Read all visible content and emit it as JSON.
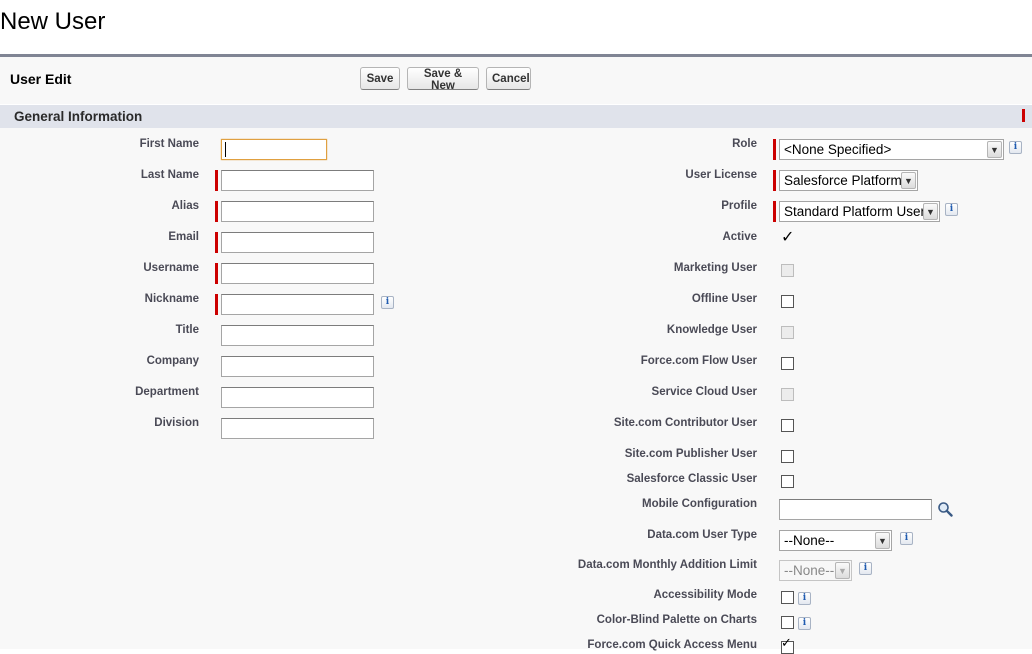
{
  "page": {
    "title": "New User"
  },
  "edit": {
    "header": "User Edit",
    "buttons": {
      "save": "Save",
      "save_new": "Save & New",
      "cancel": "Cancel"
    }
  },
  "section": {
    "title": "General Information"
  },
  "left_fields": {
    "first_name": "First Name",
    "last_name": "Last Name",
    "alias": "Alias",
    "email": "Email",
    "username": "Username",
    "nickname": "Nickname",
    "title": "Title",
    "company": "Company",
    "department": "Department",
    "division": "Division"
  },
  "right_fields": {
    "role": {
      "label": "Role",
      "value": "<None Specified>"
    },
    "user_license": {
      "label": "User License",
      "value": "Salesforce Platform"
    },
    "profile": {
      "label": "Profile",
      "value": "Standard Platform User"
    },
    "active": {
      "label": "Active",
      "checked": true
    },
    "marketing_user": {
      "label": "Marketing User",
      "checked": false,
      "disabled": true
    },
    "offline_user": {
      "label": "Offline User",
      "checked": false
    },
    "knowledge_user": {
      "label": "Knowledge User",
      "checked": false,
      "disabled": true
    },
    "flow_user": {
      "label": "Force.com Flow User",
      "checked": false
    },
    "service_cloud_user": {
      "label": "Service Cloud User",
      "checked": false,
      "disabled": true
    },
    "site_contributor": {
      "label": "Site.com Contributor User",
      "checked": false
    },
    "site_publisher": {
      "label": "Site.com Publisher User",
      "checked": false
    },
    "classic_user": {
      "label": "Salesforce Classic User",
      "checked": false
    },
    "mobile_config": {
      "label": "Mobile Configuration",
      "value": ""
    },
    "datacom_user_type": {
      "label": "Data.com User Type",
      "value": "--None--"
    },
    "datacom_monthly_limit": {
      "label": "Data.com Monthly Addition Limit",
      "value": "--None--",
      "disabled": true
    },
    "accessibility_mode": {
      "label": "Accessibility Mode",
      "checked": false
    },
    "color_blind": {
      "label": "Color-Blind Palette on Charts",
      "checked": false
    },
    "quick_access_menu": {
      "label": "Force.com Quick Access Menu",
      "checked": true
    }
  },
  "icons": {
    "info": "i",
    "check": "✓",
    "dropdown": "▼"
  },
  "colors": {
    "required": "#cc0000",
    "section_bg": "#e0e3eb",
    "rule": "#808594"
  }
}
